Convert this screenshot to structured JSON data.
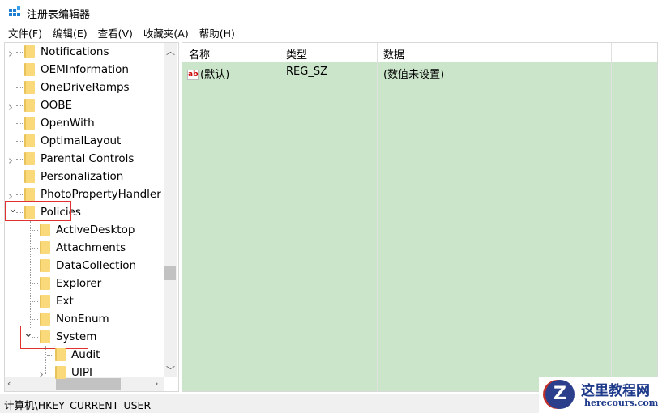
{
  "window": {
    "title": "注册表编辑器"
  },
  "menu": [
    "文件(F)",
    "编辑(E)",
    "查看(V)",
    "收藏夹(A)",
    "帮助(H)"
  ],
  "tree": [
    {
      "label": "Notifications",
      "level": 1,
      "expander": "collapsed"
    },
    {
      "label": "OEMInformation",
      "level": 1,
      "expander": "none"
    },
    {
      "label": "OneDriveRamps",
      "level": 1,
      "expander": "none"
    },
    {
      "label": "OOBE",
      "level": 1,
      "expander": "collapsed"
    },
    {
      "label": "OpenWith",
      "level": 1,
      "expander": "none"
    },
    {
      "label": "OptimalLayout",
      "level": 1,
      "expander": "none"
    },
    {
      "label": "Parental Controls",
      "level": 1,
      "expander": "collapsed"
    },
    {
      "label": "Personalization",
      "level": 1,
      "expander": "none"
    },
    {
      "label": "PhotoPropertyHandler",
      "level": 1,
      "expander": "collapsed"
    },
    {
      "label": "Policies",
      "level": 1,
      "expander": "expanded",
      "highlighted": true
    },
    {
      "label": "ActiveDesktop",
      "level": 2,
      "expander": "none"
    },
    {
      "label": "Attachments",
      "level": 2,
      "expander": "none"
    },
    {
      "label": "DataCollection",
      "level": 2,
      "expander": "none"
    },
    {
      "label": "Explorer",
      "level": 2,
      "expander": "none"
    },
    {
      "label": "Ext",
      "level": 2,
      "expander": "none"
    },
    {
      "label": "NonEnum",
      "level": 2,
      "expander": "none"
    },
    {
      "label": "System",
      "level": 2,
      "expander": "expanded",
      "highlighted": true
    },
    {
      "label": "Audit",
      "level": 3,
      "expander": "none"
    },
    {
      "label": "UIPI",
      "level": 3,
      "expander": "collapsed"
    }
  ],
  "list": {
    "columns": [
      "名称",
      "类型",
      "数据"
    ],
    "rows": [
      {
        "name": "(默认)",
        "type": "REG_SZ",
        "data": "(数值未设置)",
        "icon": "ab"
      }
    ]
  },
  "status": "计算机\\HKEY_CURRENT_USER",
  "watermark": {
    "title": "这里教程网",
    "url": "herecours.com"
  },
  "colors": {
    "list_bg": "#cbe5cb",
    "highlight_box": "#e03030"
  }
}
